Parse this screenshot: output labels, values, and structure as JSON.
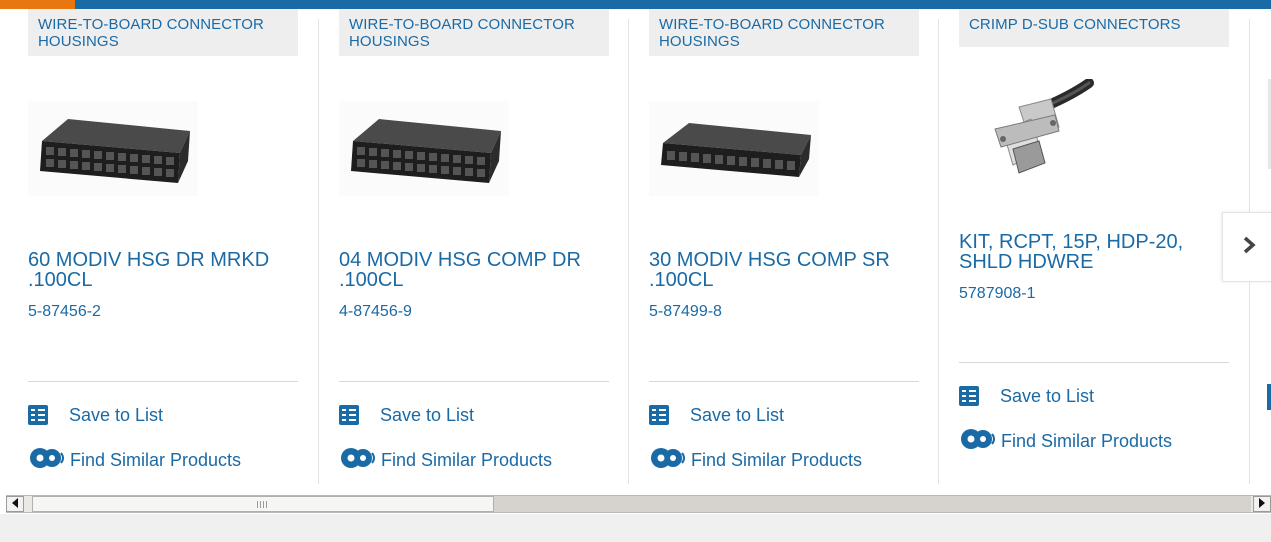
{
  "products": [
    {
      "category": "WIRE-TO-BOARD CONNECTOR HOUSINGS",
      "title": "60 MODIV HSG DR MRKD .100CL",
      "part_number": "5-87456-2",
      "image": "black-double-row-connector-housing"
    },
    {
      "category": "WIRE-TO-BOARD CONNECTOR HOUSINGS",
      "title": "04 MODIV HSG COMP DR .100CL",
      "part_number": "4-87456-9",
      "image": "black-double-row-connector-housing"
    },
    {
      "category": "WIRE-TO-BOARD CONNECTOR HOUSINGS",
      "title": "30 MODIV HSG COMP SR .100CL",
      "part_number": "5-87499-8",
      "image": "black-single-row-connector-housing"
    },
    {
      "category": "CRIMP D-SUB CONNECTORS",
      "title": "KIT, RCPT, 15P, HDP-20, SHLD HDWRE",
      "part_number": "5787908-1",
      "image": "d-sub-connector-with-cable"
    }
  ],
  "actions": {
    "save_label": "Save to List",
    "similar_label": "Find Similar Products"
  },
  "icons": {
    "save": "checklist-icon",
    "similar": "gears-icon",
    "next": "chevron-right-icon"
  },
  "colors": {
    "link": "#1a6aa6",
    "top_bar": "#1a6aa6",
    "top_bar_accent": "#e8770f",
    "category_bg": "#eeeeee"
  }
}
